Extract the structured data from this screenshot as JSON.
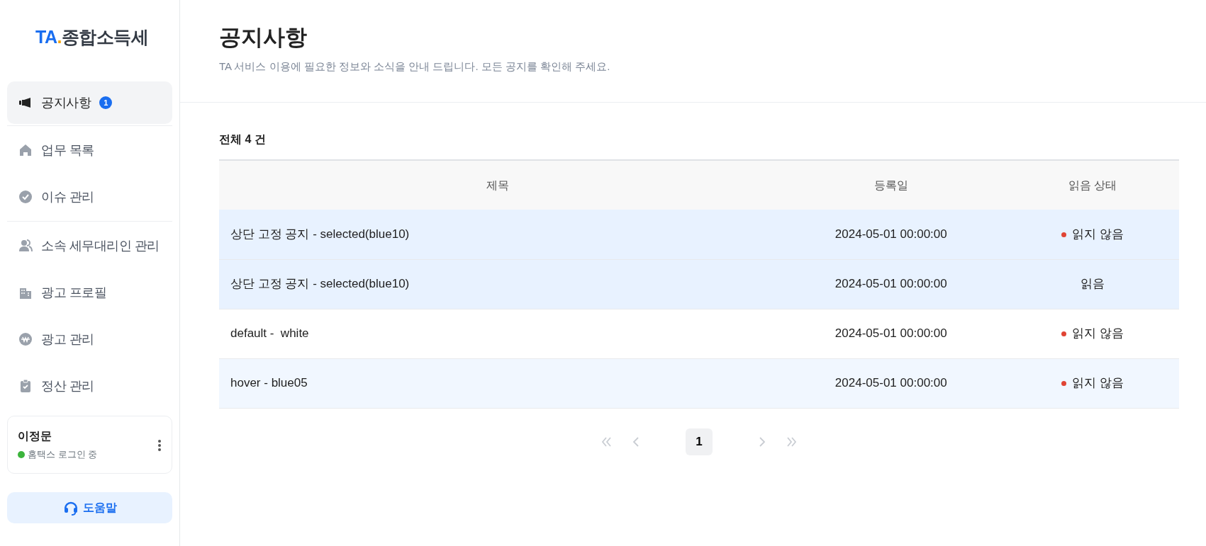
{
  "logo": {
    "brand": "TA",
    "dot": ".",
    "product": "종합소득세"
  },
  "nav_groups": [
    [
      {
        "label": "공지사항",
        "badge": "1",
        "selected": true
      }
    ],
    [
      {
        "label": "업무 목록",
        "selected": false
      },
      {
        "label": "이슈 관리",
        "selected": false
      }
    ],
    [
      {
        "label": "소속 세무대리인 관리",
        "selected": false
      },
      {
        "label": "광고 프로필",
        "selected": false
      },
      {
        "label": "광고 관리",
        "selected": false
      },
      {
        "label": "정산 관리",
        "selected": false
      }
    ]
  ],
  "user": {
    "name": "이정문",
    "status": "홈택스 로그인 중"
  },
  "help_button": "도움말",
  "page": {
    "title": "공지사항",
    "subtitle": "TA 서비스 이용에 필요한 정보와 소식을 안내 드립니다. 모든 공지를 확인해 주세요."
  },
  "total": {
    "label": "전체",
    "count": "4",
    "unit": "건"
  },
  "table": {
    "columns": [
      "제목",
      "등록일",
      "읽음 상태"
    ],
    "rows": [
      {
        "title": "상단 고정 공지 - selected(blue10)",
        "date": "2024-05-01 00:00:00",
        "status": "읽지 않음",
        "unread": true,
        "kind": "selected"
      },
      {
        "title": "상단 고정 공지 - selected(blue10)",
        "date": "2024-05-01 00:00:00",
        "status": "읽음",
        "unread": false,
        "kind": "selected"
      },
      {
        "title": "default -  white",
        "date": "2024-05-01 00:00:00",
        "status": "읽지 않음",
        "unread": true,
        "kind": "default"
      },
      {
        "title": "hover - blue05",
        "date": "2024-05-01 00:00:00",
        "status": "읽지 않음",
        "unread": true,
        "kind": "hover"
      }
    ]
  },
  "pagination": {
    "controls": [
      {
        "kind": "first",
        "disabled": true
      },
      {
        "kind": "prev",
        "disabled": true
      },
      {
        "kind": "page",
        "label": "1",
        "selected": true
      },
      {
        "kind": "next",
        "disabled": true
      },
      {
        "kind": "last",
        "disabled": true
      }
    ]
  }
}
